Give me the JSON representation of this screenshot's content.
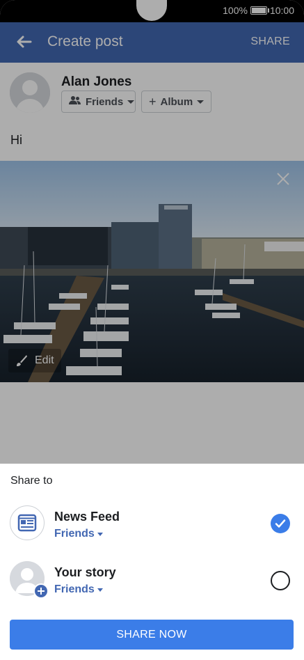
{
  "status": {
    "battery": "100%",
    "time": "10:00"
  },
  "header": {
    "title": "Create post",
    "share_label": "SHARE"
  },
  "composer": {
    "user_name": "Alan Jones",
    "audience_label": "Friends",
    "album_label": "Album",
    "post_text": "Hi",
    "photo_edit_label": "Edit"
  },
  "sheet": {
    "title": "Share to",
    "options": [
      {
        "label": "News Feed",
        "audience": "Friends",
        "selected": true,
        "icon": "news-feed-icon"
      },
      {
        "label": "Your story",
        "audience": "Friends",
        "selected": false,
        "icon": "story-avatar-icon"
      }
    ],
    "share_now_label": "SHARE NOW"
  },
  "colors": {
    "brand": "#4267b2",
    "accent": "#3b7de8"
  }
}
